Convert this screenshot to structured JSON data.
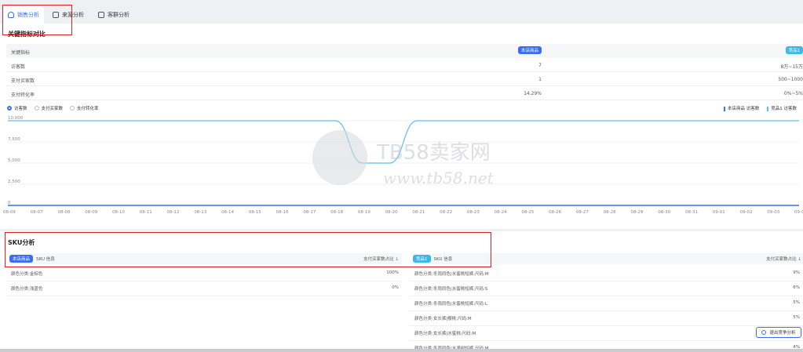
{
  "tabs": [
    {
      "label": "销售分析",
      "active": true
    },
    {
      "label": "来源分析",
      "active": false
    },
    {
      "label": "客群分析",
      "active": false
    }
  ],
  "key_metrics": {
    "title": "关键指标对比",
    "header": {
      "label": "关键指标",
      "self_badge": "本店商品",
      "comp_badge": "竞品1"
    },
    "rows": [
      {
        "label": "访客数",
        "self": "7",
        "comp": "8万~15万"
      },
      {
        "label": "支付买家数",
        "self": "1",
        "comp": "500~1000"
      },
      {
        "label": "支付转化率",
        "self": "14.29%",
        "comp": "0%~5%"
      }
    ]
  },
  "chart_controls": {
    "metrics": [
      "访客数",
      "支付买家数",
      "支付转化率"
    ],
    "selected": "访客数",
    "legend": [
      "本店商品 访客数",
      "竞品1 访客数"
    ]
  },
  "chart_data": {
    "type": "line",
    "x": [
      "08-06",
      "08-07",
      "08-08",
      "08-09",
      "08-10",
      "08-11",
      "08-12",
      "08-13",
      "08-14",
      "08-15",
      "08-16",
      "08-17",
      "08-18",
      "08-19",
      "08-20",
      "08-21",
      "08-22",
      "08-23",
      "08-24",
      "08-25",
      "08-26",
      "08-27",
      "08-28",
      "08-29",
      "08-30",
      "08-31",
      "09-01",
      "09-02",
      "09-03",
      "09-04"
    ],
    "yticks": [
      "10,000",
      "7,500",
      "5,000",
      "2,500",
      "0"
    ],
    "ylim": [
      0,
      10000
    ],
    "series": [
      {
        "name": "本店商品 访客数",
        "color": "#3a6cf4",
        "values": [
          0,
          0,
          0,
          0,
          0,
          0,
          0,
          0,
          0,
          0,
          0,
          0,
          0,
          0,
          0,
          0,
          0,
          0,
          0,
          0,
          0,
          0,
          0,
          0,
          0,
          0,
          0,
          0,
          0,
          0
        ]
      },
      {
        "name": "竞品1 访客数",
        "color": "#5bc0eb",
        "values": [
          10000,
          10000,
          10000,
          10000,
          10000,
          10000,
          10000,
          10000,
          10000,
          10000,
          10000,
          10000,
          10000,
          5000,
          5000,
          10000,
          10000,
          10000,
          10000,
          10000,
          10000,
          10000,
          10000,
          10000,
          10000,
          10000,
          10000,
          10000,
          10000,
          10000
        ]
      }
    ],
    "grid": true,
    "legend_position": "top-right"
  },
  "watermark": {
    "brand": "TB58卖家网",
    "url": "www.tb58.net"
  },
  "sku": {
    "title": "SKU分析",
    "left": {
      "badge": "本店商品",
      "col_info": "SKU 信息",
      "col_value": "支付买家数占比",
      "rows": [
        {
          "name": "颜色分类:金棕色",
          "value": "100%"
        },
        {
          "name": "颜色分类:浅蓝色",
          "value": "0%"
        }
      ]
    },
    "right": {
      "badge": "竞品1",
      "col_info": "SKU 信息",
      "col_value": "支付买家数占比",
      "rows": [
        {
          "name": "颜色分类:冬雨同色|水蜜桃短裤;尺码:M",
          "value": "9%"
        },
        {
          "name": "颜色分类:冬雨同色|水蜜桃短裤;尺码:S",
          "value": "6%"
        },
        {
          "name": "颜色分类:冬雨同色|水蜜桃短裤;尺码:L",
          "value": "5%"
        },
        {
          "name": "颜色分类:女长裤|樱桃;尺码:M",
          "value": "5%"
        },
        {
          "name": "颜色分类:女长裤|水蜜桃;尺码:M",
          "value": ""
        },
        {
          "name": "颜色分类:冬雨同色|水滴树短裤;尺码:M",
          "value": "4%"
        }
      ]
    }
  },
  "exit_button": {
    "label": "退出竞争分析"
  }
}
